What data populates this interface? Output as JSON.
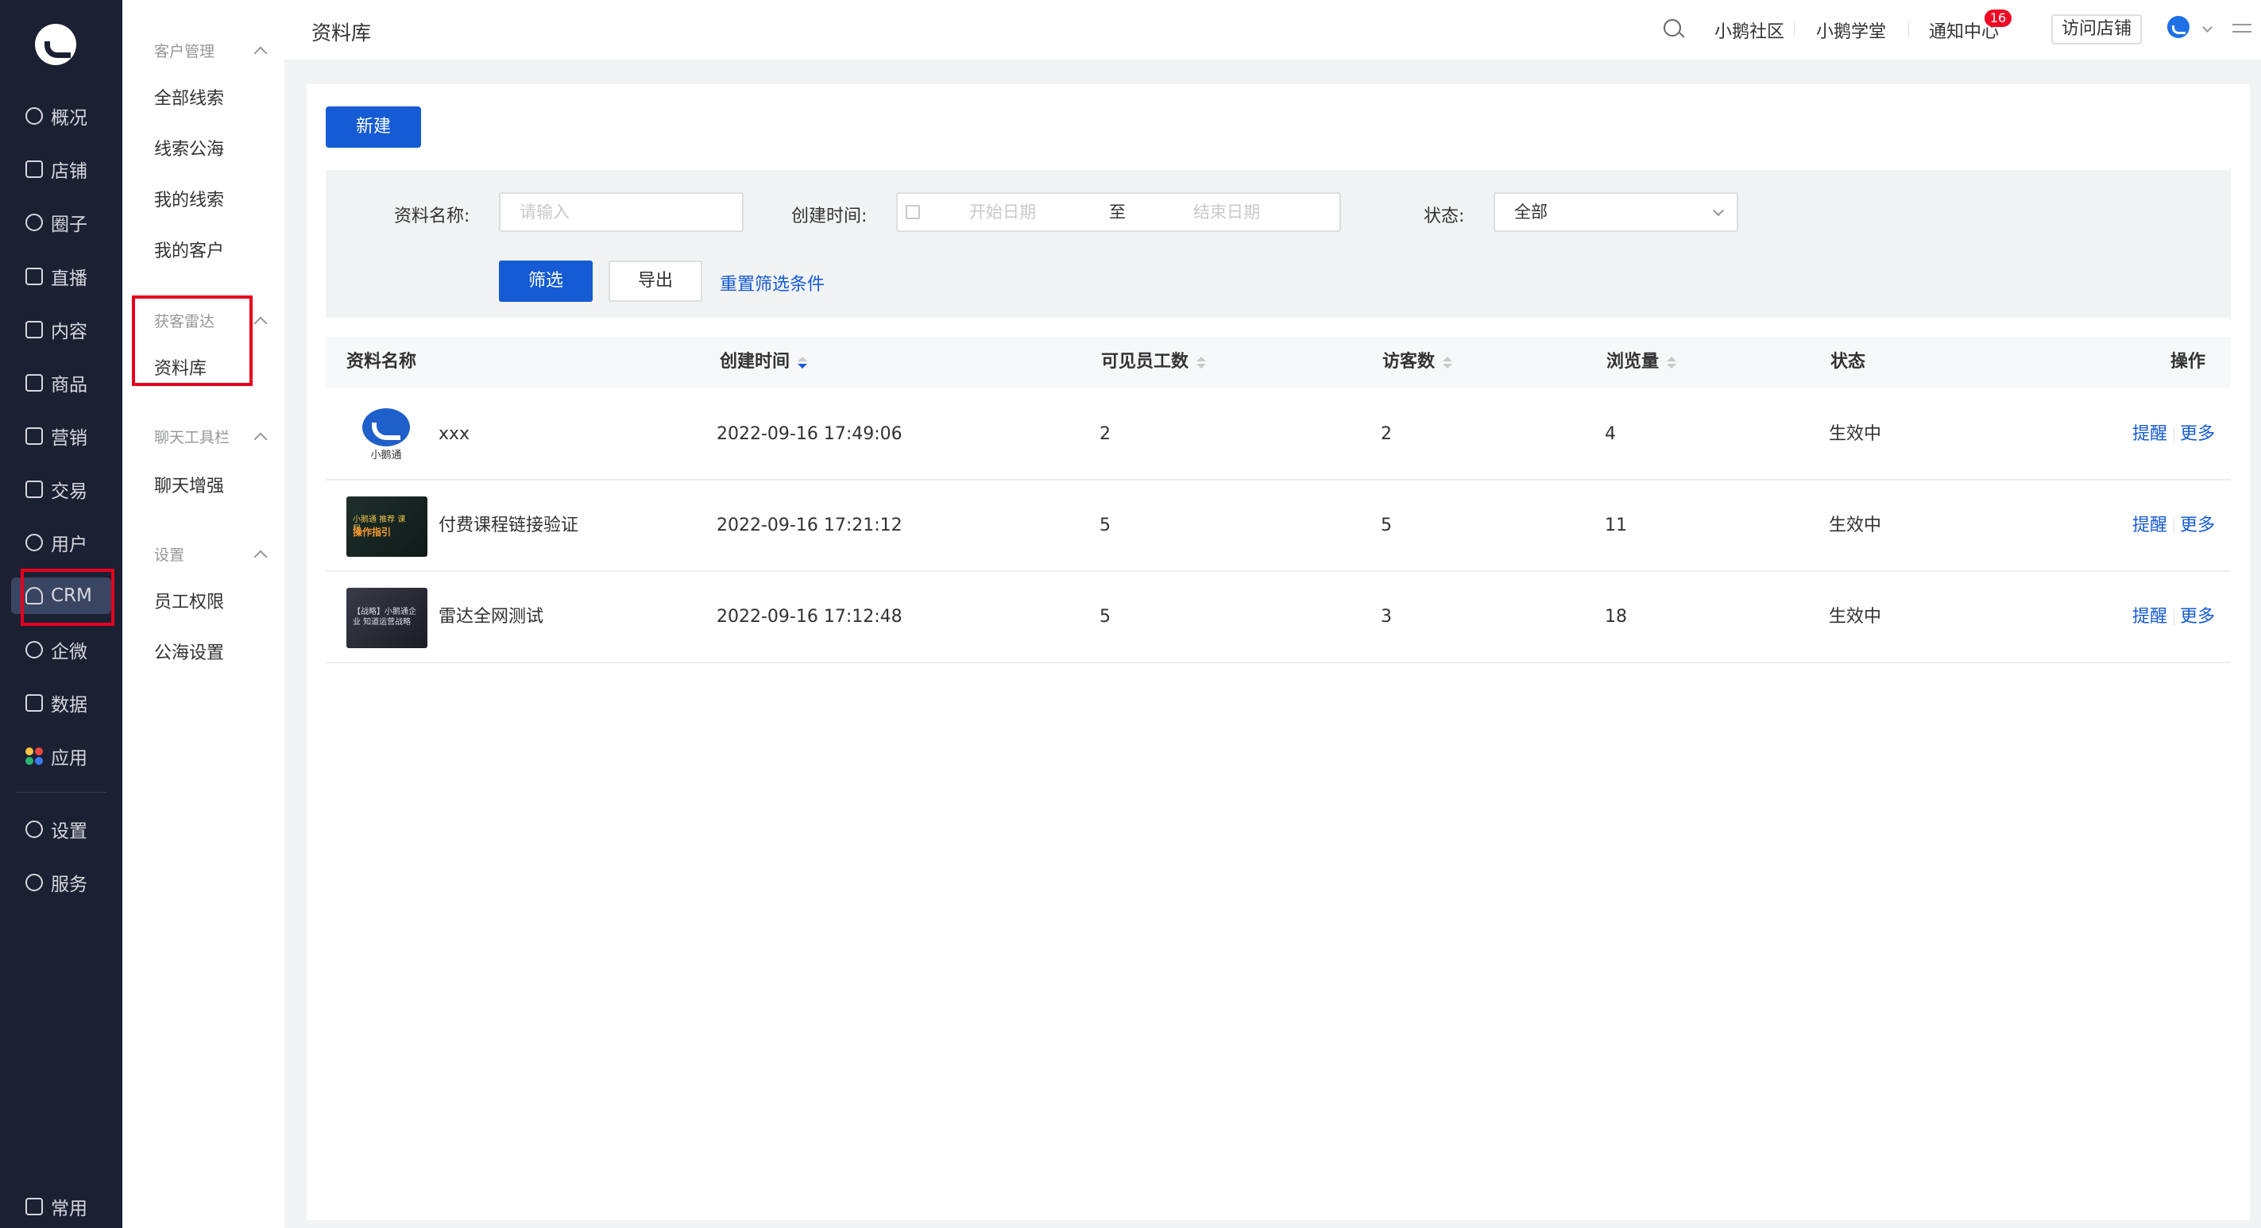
{
  "nav": {
    "items": [
      {
        "label": "概况",
        "icon": "dashboard-icon"
      },
      {
        "label": "店铺",
        "icon": "shop-icon"
      },
      {
        "label": "圈子",
        "icon": "community-icon"
      },
      {
        "label": "直播",
        "icon": "live-icon"
      },
      {
        "label": "内容",
        "icon": "content-icon"
      },
      {
        "label": "商品",
        "icon": "goods-icon"
      },
      {
        "label": "营销",
        "icon": "marketing-icon"
      },
      {
        "label": "交易",
        "icon": "trade-icon"
      },
      {
        "label": "用户",
        "icon": "user-icon"
      },
      {
        "label": "CRM",
        "icon": "crm-icon"
      },
      {
        "label": "企微",
        "icon": "wecom-icon"
      },
      {
        "label": "数据",
        "icon": "data-icon"
      },
      {
        "label": "应用",
        "icon": "apps-icon"
      },
      {
        "label": "设置",
        "icon": "settings-icon"
      },
      {
        "label": "服务",
        "icon": "service-icon"
      }
    ],
    "bottom_label": "常用",
    "active": "CRM"
  },
  "submenu": {
    "groups": [
      {
        "title": "客户管理",
        "items": [
          "全部线索",
          "线索公海",
          "我的线索",
          "我的客户"
        ]
      },
      {
        "title": "获客雷达",
        "items": [
          "资料库"
        ]
      },
      {
        "title": "聊天工具栏",
        "items": [
          "聊天增强"
        ]
      },
      {
        "title": "设置",
        "items": [
          "员工权限",
          "公海设置"
        ]
      }
    ],
    "active": "资料库"
  },
  "header": {
    "title": "资料库",
    "links": [
      "小鹅社区",
      "小鹅学堂",
      "通知中心"
    ],
    "notification_count": "16",
    "visit_store": "访问店铺"
  },
  "toolbar": {
    "new_label": "新建"
  },
  "filter": {
    "name_label": "资料名称:",
    "name_placeholder": "请输入",
    "time_label": "创建时间:",
    "start_placeholder": "开始日期",
    "range_sep": "至",
    "end_placeholder": "结束日期",
    "status_label": "状态:",
    "status_value": "全部",
    "filter_btn": "筛选",
    "export_btn": "导出",
    "reset_link": "重置筛选条件"
  },
  "table": {
    "columns": [
      "资料名称",
      "创建时间",
      "可见员工数",
      "访客数",
      "浏览量",
      "状态",
      "操作"
    ],
    "rows": [
      {
        "name": "xxx",
        "thumb_text": "小鹅通",
        "created": "2022-09-16 17:49:06",
        "staff": "2",
        "visitors": "2",
        "views": "4",
        "status": "生效中"
      },
      {
        "name": "付费课程链接验证",
        "thumb_text": "小鹅通 推荐 课程",
        "thumb_title": "操作指引",
        "created": "2022-09-16 17:21:12",
        "staff": "5",
        "visitors": "5",
        "views": "11",
        "status": "生效中"
      },
      {
        "name": "雷达全网测试",
        "thumb_text": "【战略】小鹅通企业 知道运营战略",
        "created": "2022-09-16 17:12:48",
        "staff": "5",
        "visitors": "3",
        "views": "18",
        "status": "生效中"
      }
    ],
    "op_remind": "提醒",
    "op_more": "更多"
  },
  "colors": {
    "nav_bg": "#1c2033",
    "primary": "#155bd4",
    "highlight_box": "#e6001d",
    "badge": "#ee0a24"
  }
}
